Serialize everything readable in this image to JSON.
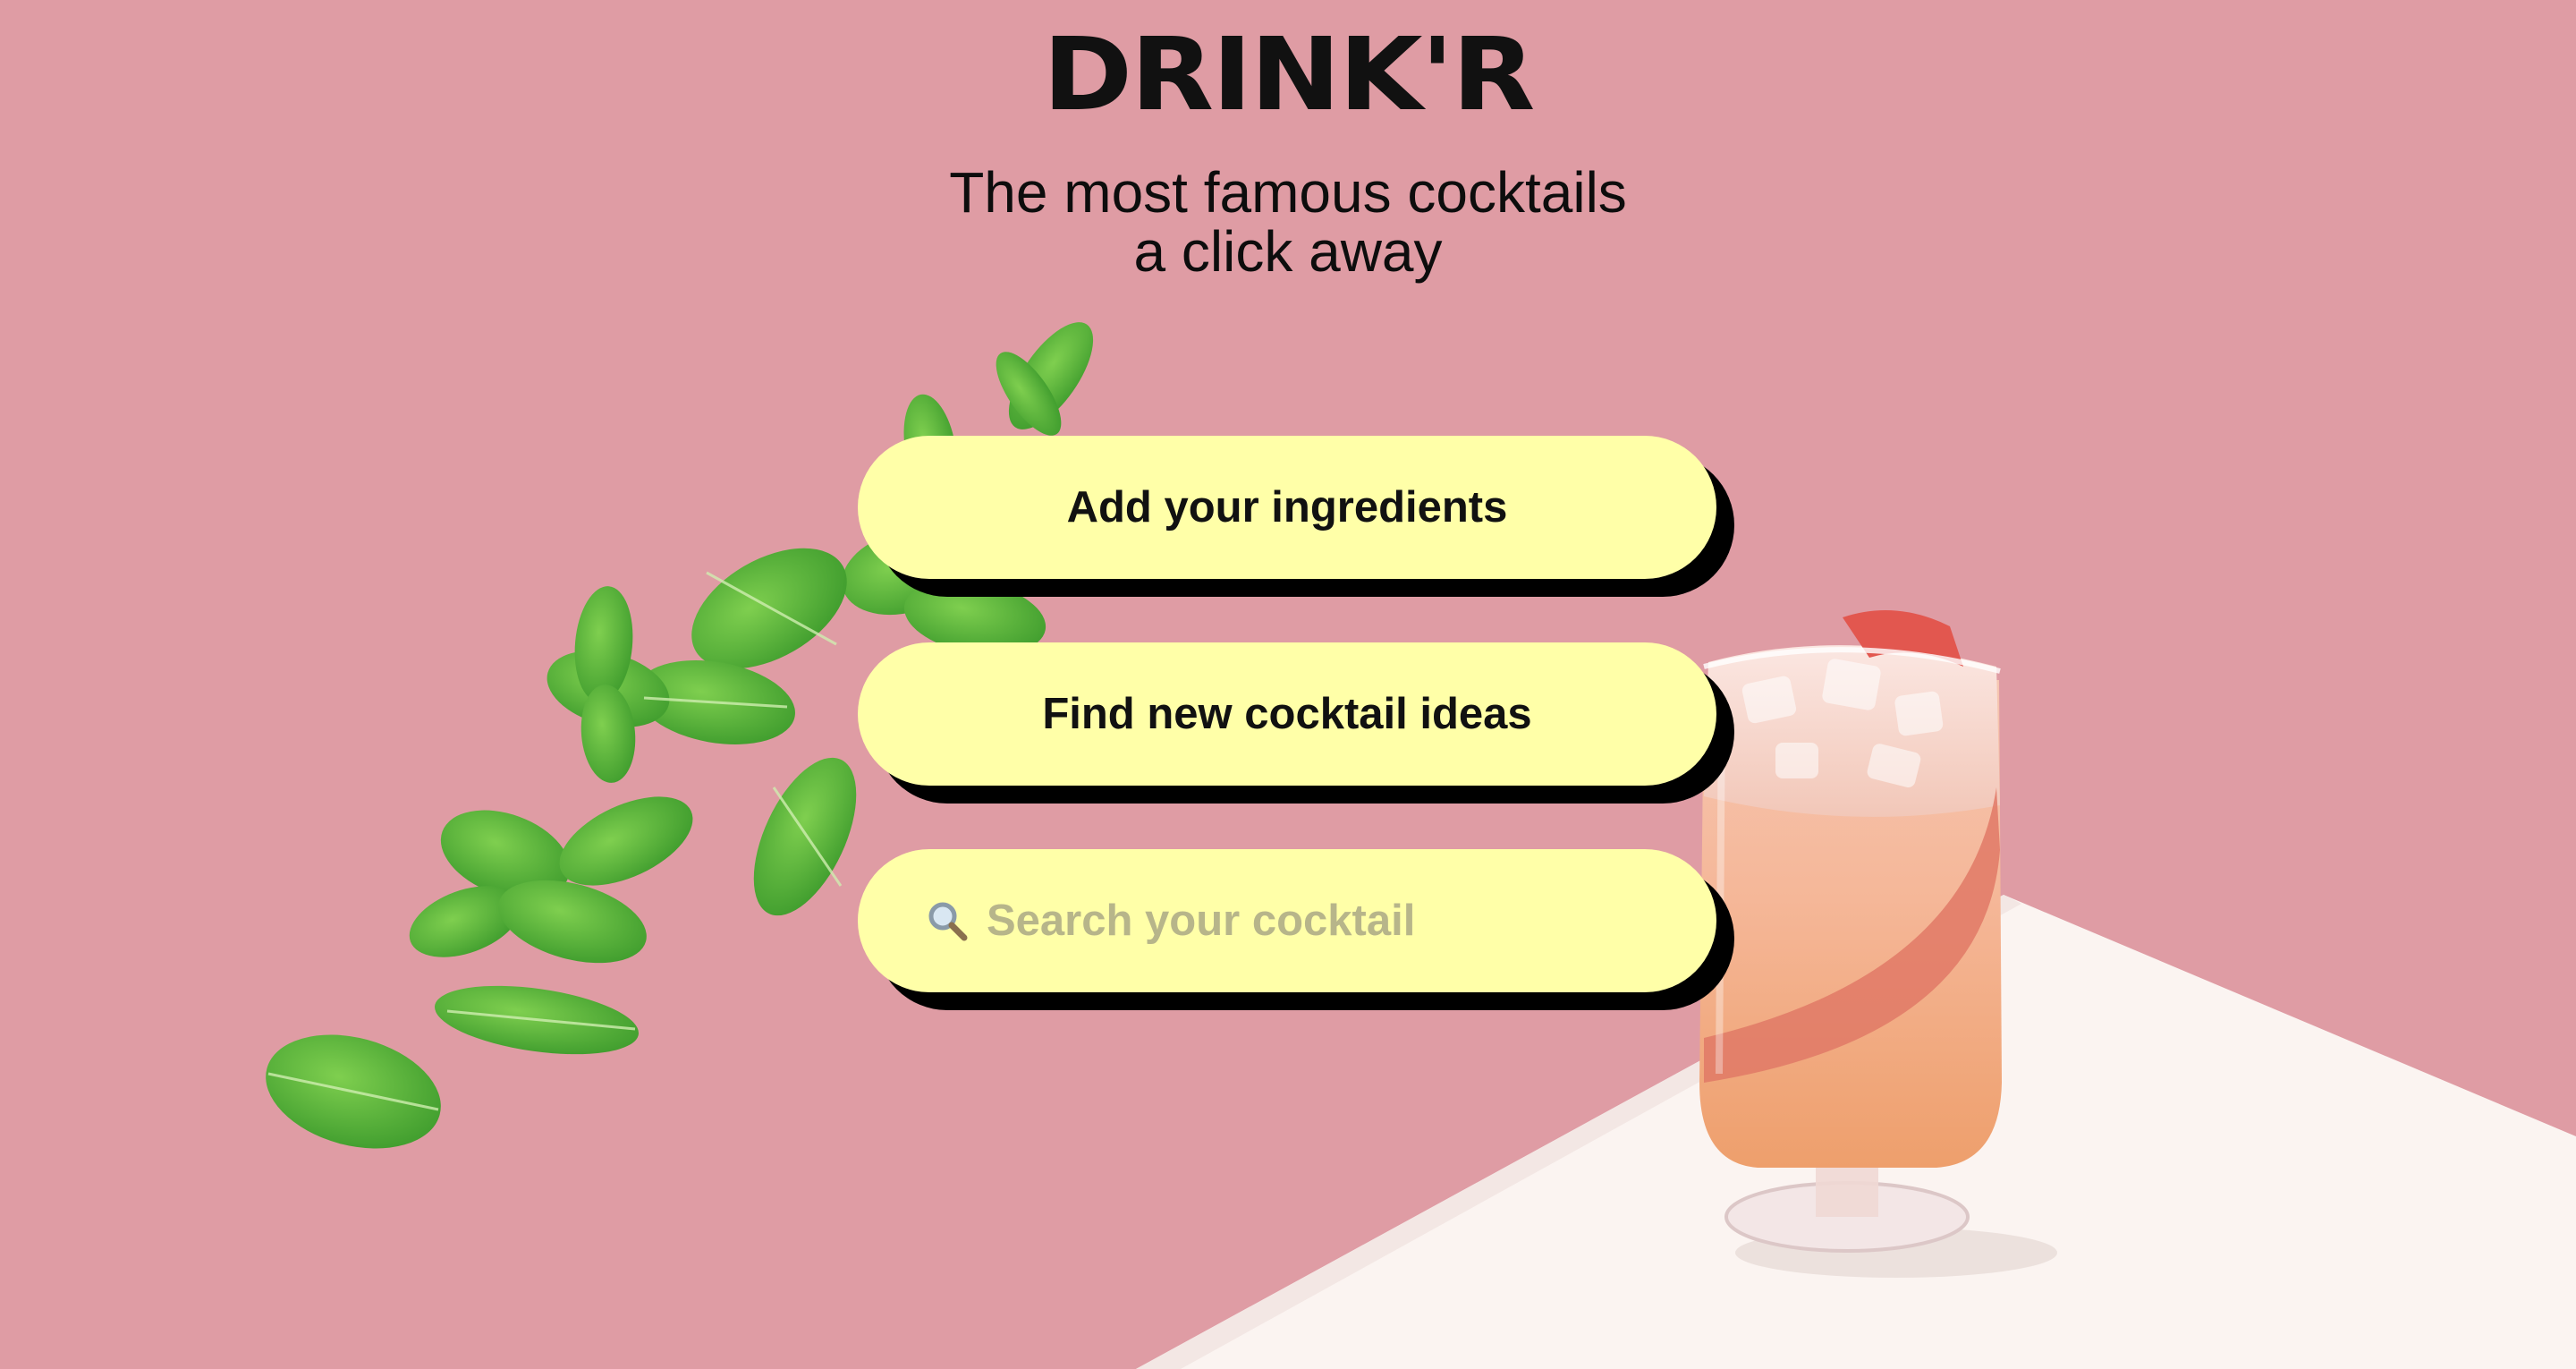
{
  "header": {
    "logo_text": "DRINK'R",
    "tagline_line1": "The most famous cocktails",
    "tagline_line2": "a click away"
  },
  "actions": {
    "add_ingredients_label": "Add your ingredients",
    "find_ideas_label": "Find new cocktail ideas"
  },
  "search": {
    "icon": "search-icon",
    "placeholder": "Search your cocktail",
    "value": ""
  },
  "colors": {
    "background": "#df9ca4",
    "table_surface": "#fbf4f1",
    "button_fill": "#ffffa8",
    "button_shadow": "#000000",
    "text": "#111111"
  },
  "decor": {
    "left_image": "mint-leaves",
    "right_image": "rhubarb-cocktail-glass"
  }
}
